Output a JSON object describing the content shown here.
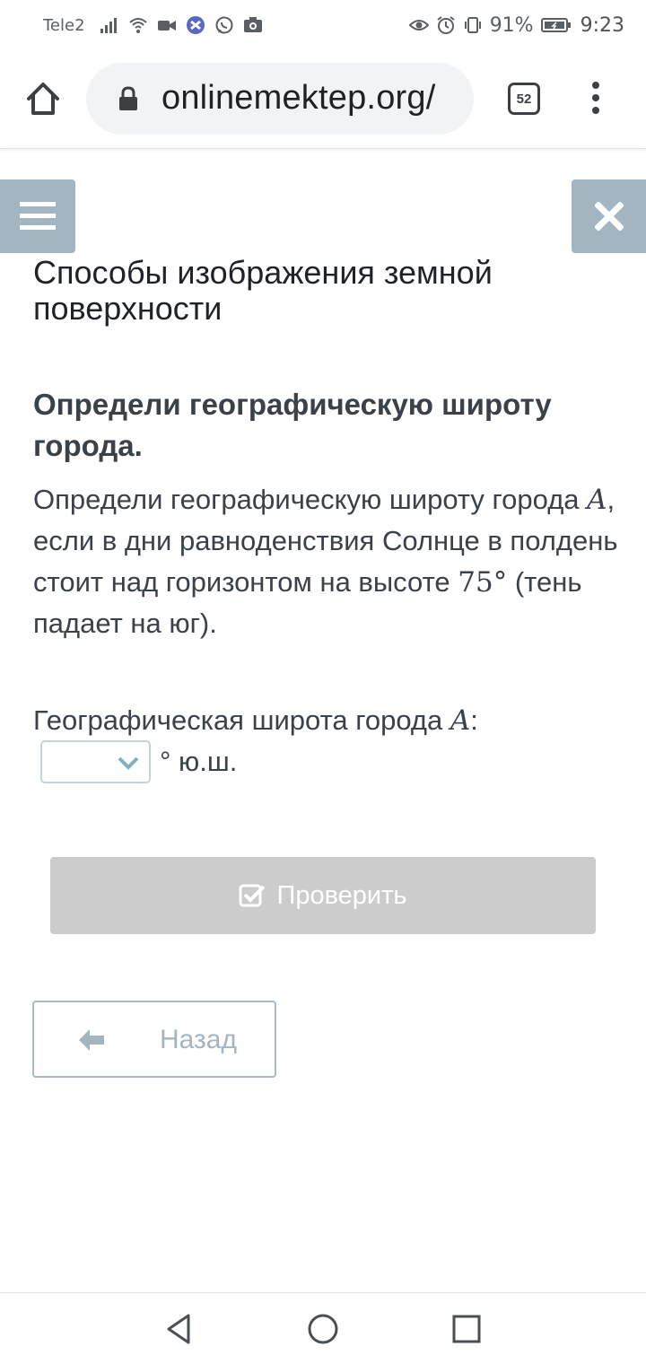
{
  "status_bar": {
    "carrier": "Tele2",
    "battery": "91%",
    "time": "9:23"
  },
  "browser": {
    "url": "onlinemektep.org/",
    "tab_count": "52"
  },
  "page": {
    "title": "Способы изображения земной поверхности",
    "task_title": "Определи географическую широту города.",
    "task_text": {
      "part1": "Определи географическую широту города ",
      "var": "A",
      "part2": ", если в дни равноденствия Солнце в полдень стоит над горизонтом на высоте ",
      "angle": "75°",
      "part3": " (тень падает на юг)."
    },
    "answer": {
      "label": "Географическая широта города ",
      "var": "A",
      "colon": ":",
      "selected": "",
      "unit": "° ю.ш."
    },
    "check_button": "Проверить",
    "back_button": "Назад"
  },
  "colors": {
    "side_buttons": "#a3b5c1",
    "check_button_disabled": "#cccccc",
    "text": "#3a4149"
  }
}
